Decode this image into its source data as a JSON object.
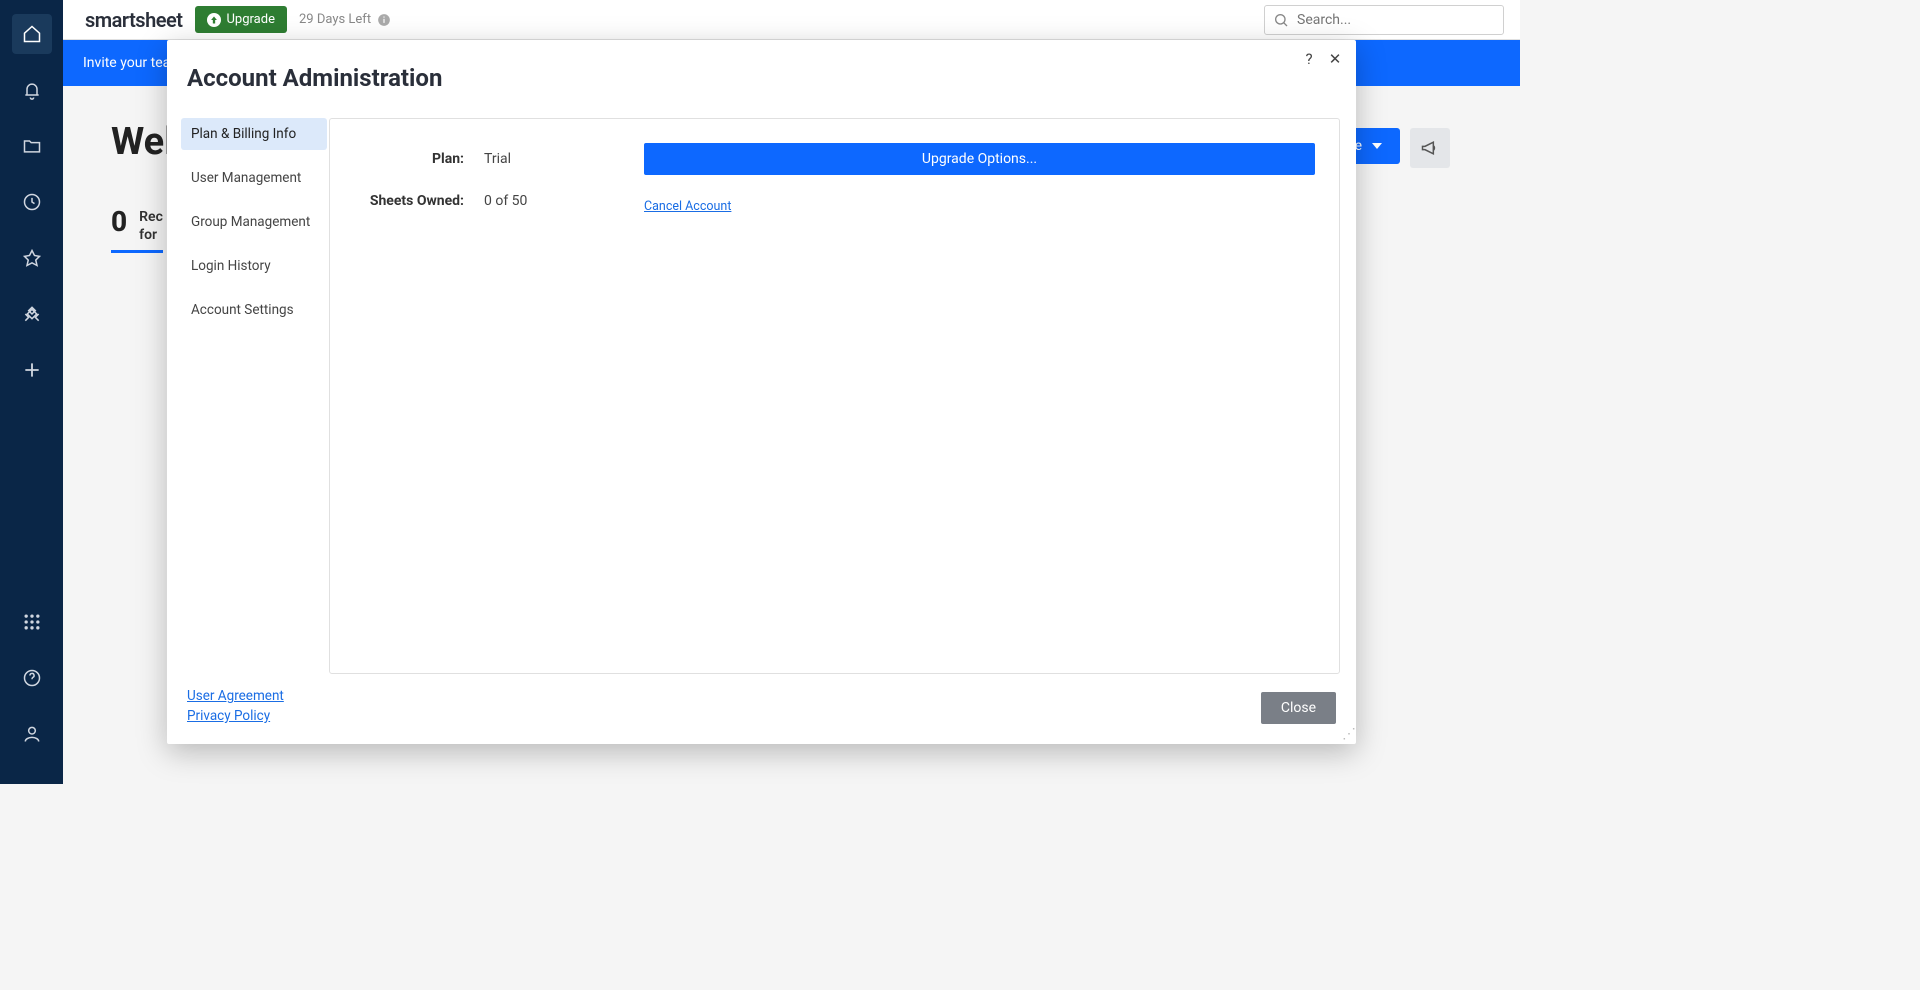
{
  "topbar": {
    "logo": "smartsheet",
    "upgrade_btn": "Upgrade",
    "days_left": "29 Days Left",
    "search_placeholder": "Search..."
  },
  "banner": {
    "invite_text": "Invite your tea"
  },
  "page": {
    "welcome_fragment": "Wel",
    "tab_count": "0",
    "tab_line1": "Rec",
    "tab_line2": "for",
    "create_btn_fragment": "ate"
  },
  "dialog": {
    "title": "Account Administration",
    "help_glyph": "?",
    "close_glyph": "✕",
    "sidebar": {
      "items": [
        "Plan & Billing Info",
        "User Management",
        "Group Management",
        "Login History",
        "Account Settings"
      ],
      "active_index": 0
    },
    "content": {
      "plan_label": "Plan:",
      "plan_value": "Trial",
      "sheets_label": "Sheets Owned:",
      "sheets_value": "0 of 50",
      "upgrade_options_btn": "Upgrade Options...",
      "cancel_account_link": "Cancel Account"
    },
    "footer": {
      "user_agreement": "User Agreement",
      "privacy_policy": "Privacy Policy",
      "close_btn": "Close"
    }
  }
}
